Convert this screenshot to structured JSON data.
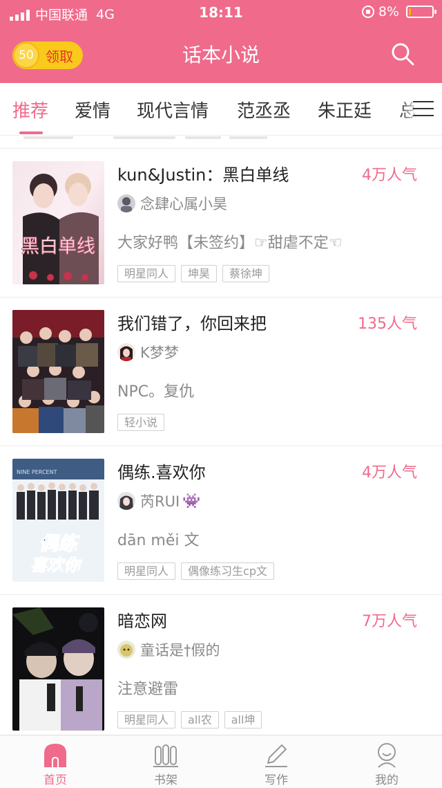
{
  "status_bar": {
    "carrier": "中国联通",
    "network": "4G",
    "time": "18:11",
    "battery": "8%",
    "battery_level": 0.08
  },
  "header": {
    "coin_value": "50",
    "claim_label": "领取",
    "title": "话本小说",
    "icons": {
      "search": "search-icon"
    }
  },
  "tabs": {
    "items": [
      "推荐",
      "爱情",
      "现代言情",
      "范丞丞",
      "朱正廷",
      "总"
    ],
    "active": "推荐",
    "menu_icon": "menu-icon"
  },
  "books": [
    {
      "title": "kun&Justin：黑白单线",
      "popularity": "4万人气",
      "author": "念肆心属小昊",
      "description": "大家好鸭【未签约】☞甜虐不定☜",
      "tags": [
        "明星同人",
        "坤昊",
        "蔡徐坤"
      ],
      "cover_text": "黑白单线"
    },
    {
      "title": "我们错了，你回来把",
      "popularity": "135人气",
      "author": "K梦梦",
      "description": "NPC。复仇",
      "tags": [
        "轻小说"
      ]
    },
    {
      "title": "偶练.喜欢你",
      "popularity": "4万人气",
      "author": "芮RUI",
      "author_emoji": "👾",
      "description": "dān měi 文",
      "tags": [
        "明星同人",
        "偶像练习生cp文"
      ],
      "cover_text": {
        "top": "NINE PERCENT",
        "main_1": "偶练",
        "main_2": "喜欢你"
      }
    },
    {
      "title": "暗恋网",
      "popularity": "7万人气",
      "author": "童话是†假的",
      "description": "注意避雷",
      "tags": [
        "明星同人",
        "all农",
        "all坤"
      ]
    }
  ],
  "bottom_nav": [
    {
      "label": "首页",
      "icon": "home-icon",
      "active": true
    },
    {
      "label": "书架",
      "icon": "bookshelf-icon",
      "active": false
    },
    {
      "label": "写作",
      "icon": "pen-icon",
      "active": false
    },
    {
      "label": "我的",
      "icon": "profile-icon",
      "active": false
    }
  ],
  "colors": {
    "brand": "#f06a8b",
    "coin": "#f9c91c",
    "claim_text": "#e2371f",
    "muted": "#8a8a8a"
  }
}
